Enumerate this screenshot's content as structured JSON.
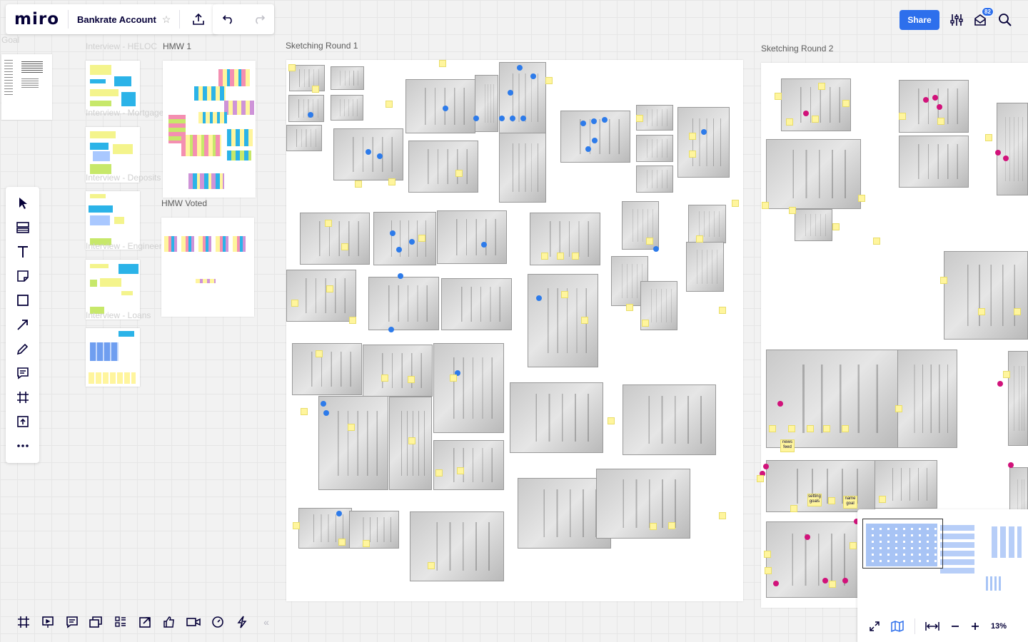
{
  "app": {
    "logo": "miro",
    "board_name": "Bankrate Account"
  },
  "topbar": {
    "share_label": "Share",
    "notification_count": "82"
  },
  "canvas": {
    "labels": {
      "goal": "Goal",
      "interview_heloc": "Interview - HELOC",
      "hmw1": "HMW 1",
      "interview_mortgage": "Interview - Mortgage",
      "interview_deposits": "Interview - Deposits",
      "hmw_voted": "HMW Voted",
      "interview_engineering": "Interview - Engineering",
      "interview_loans": "Interview - Loans",
      "sketching_round_1": "Sketching Round 1",
      "sketching_round_2": "Sketching Round 2"
    },
    "sticky_notes": {
      "news_feed": "news feed",
      "setting_goals": "setting goals",
      "name_goal": "name goal"
    }
  },
  "minimap": {
    "zoom": "13%"
  },
  "colors": {
    "share": "#2d6fec",
    "blue_dot": "#2d7bea",
    "pink_dot": "#d1127a",
    "sticky_yellow": "#fff59d"
  },
  "icons": {
    "left_tools": [
      "select-icon",
      "templates-icon",
      "text-icon",
      "sticky-note-icon",
      "shape-icon",
      "arrow-icon",
      "pen-icon",
      "comment-icon",
      "frame-icon",
      "upload-icon",
      "more-icon"
    ],
    "bottom_tools": [
      "frames-icon",
      "presentation-icon",
      "comments-icon",
      "cards-icon",
      "kanban-icon",
      "screen-share-icon",
      "voting-icon",
      "video-icon",
      "timer-icon",
      "lightning-icon",
      "collapse-icon"
    ]
  }
}
